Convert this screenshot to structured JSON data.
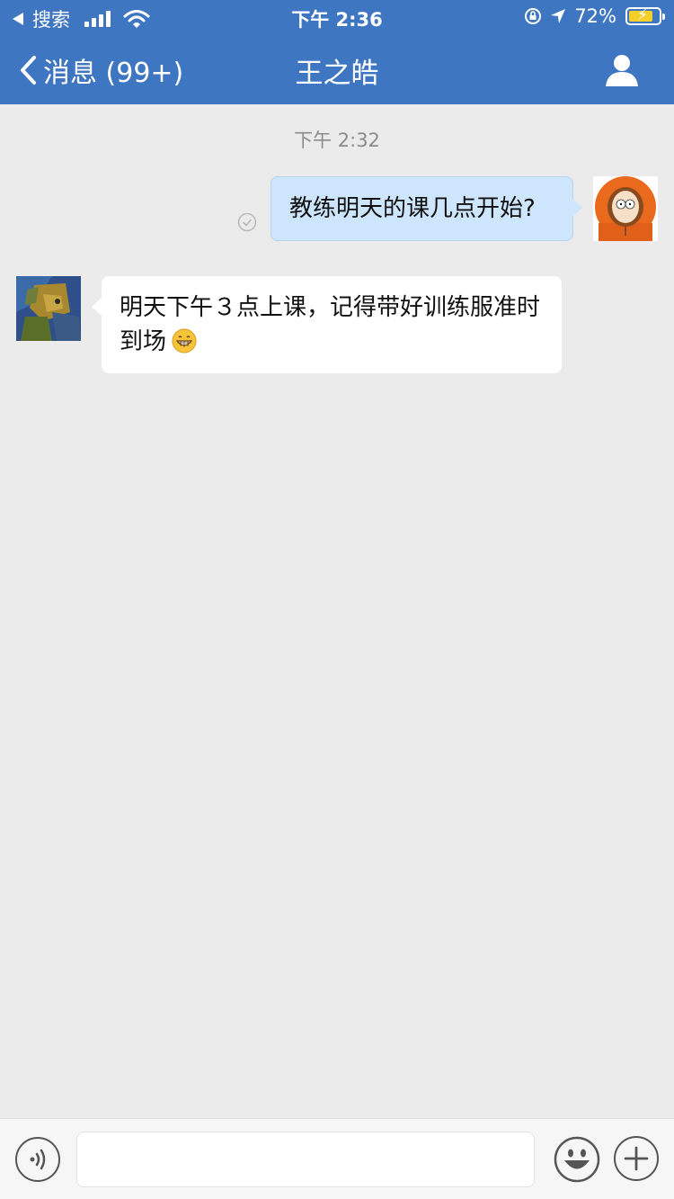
{
  "status_bar": {
    "back_label": "搜索",
    "time": "下午 2:36",
    "battery": "72%",
    "battery_level": 0.72
  },
  "nav": {
    "back_label": "消息 (99+)",
    "title": "王之皓"
  },
  "chat": {
    "timestamp": "下午 2:32",
    "messages": [
      {
        "direction": "out",
        "text": "教练明天的课几点开始?"
      },
      {
        "direction": "in",
        "text": "明天下午３点上课，记得带好训练服准时到场",
        "emoji": "grinning-face"
      }
    ]
  },
  "input_bar": {
    "placeholder": ""
  },
  "colors": {
    "header": "#3f76c2",
    "background": "#ebebeb",
    "bubble_out": "#cde6fd",
    "bubble_in": "#ffffff"
  }
}
